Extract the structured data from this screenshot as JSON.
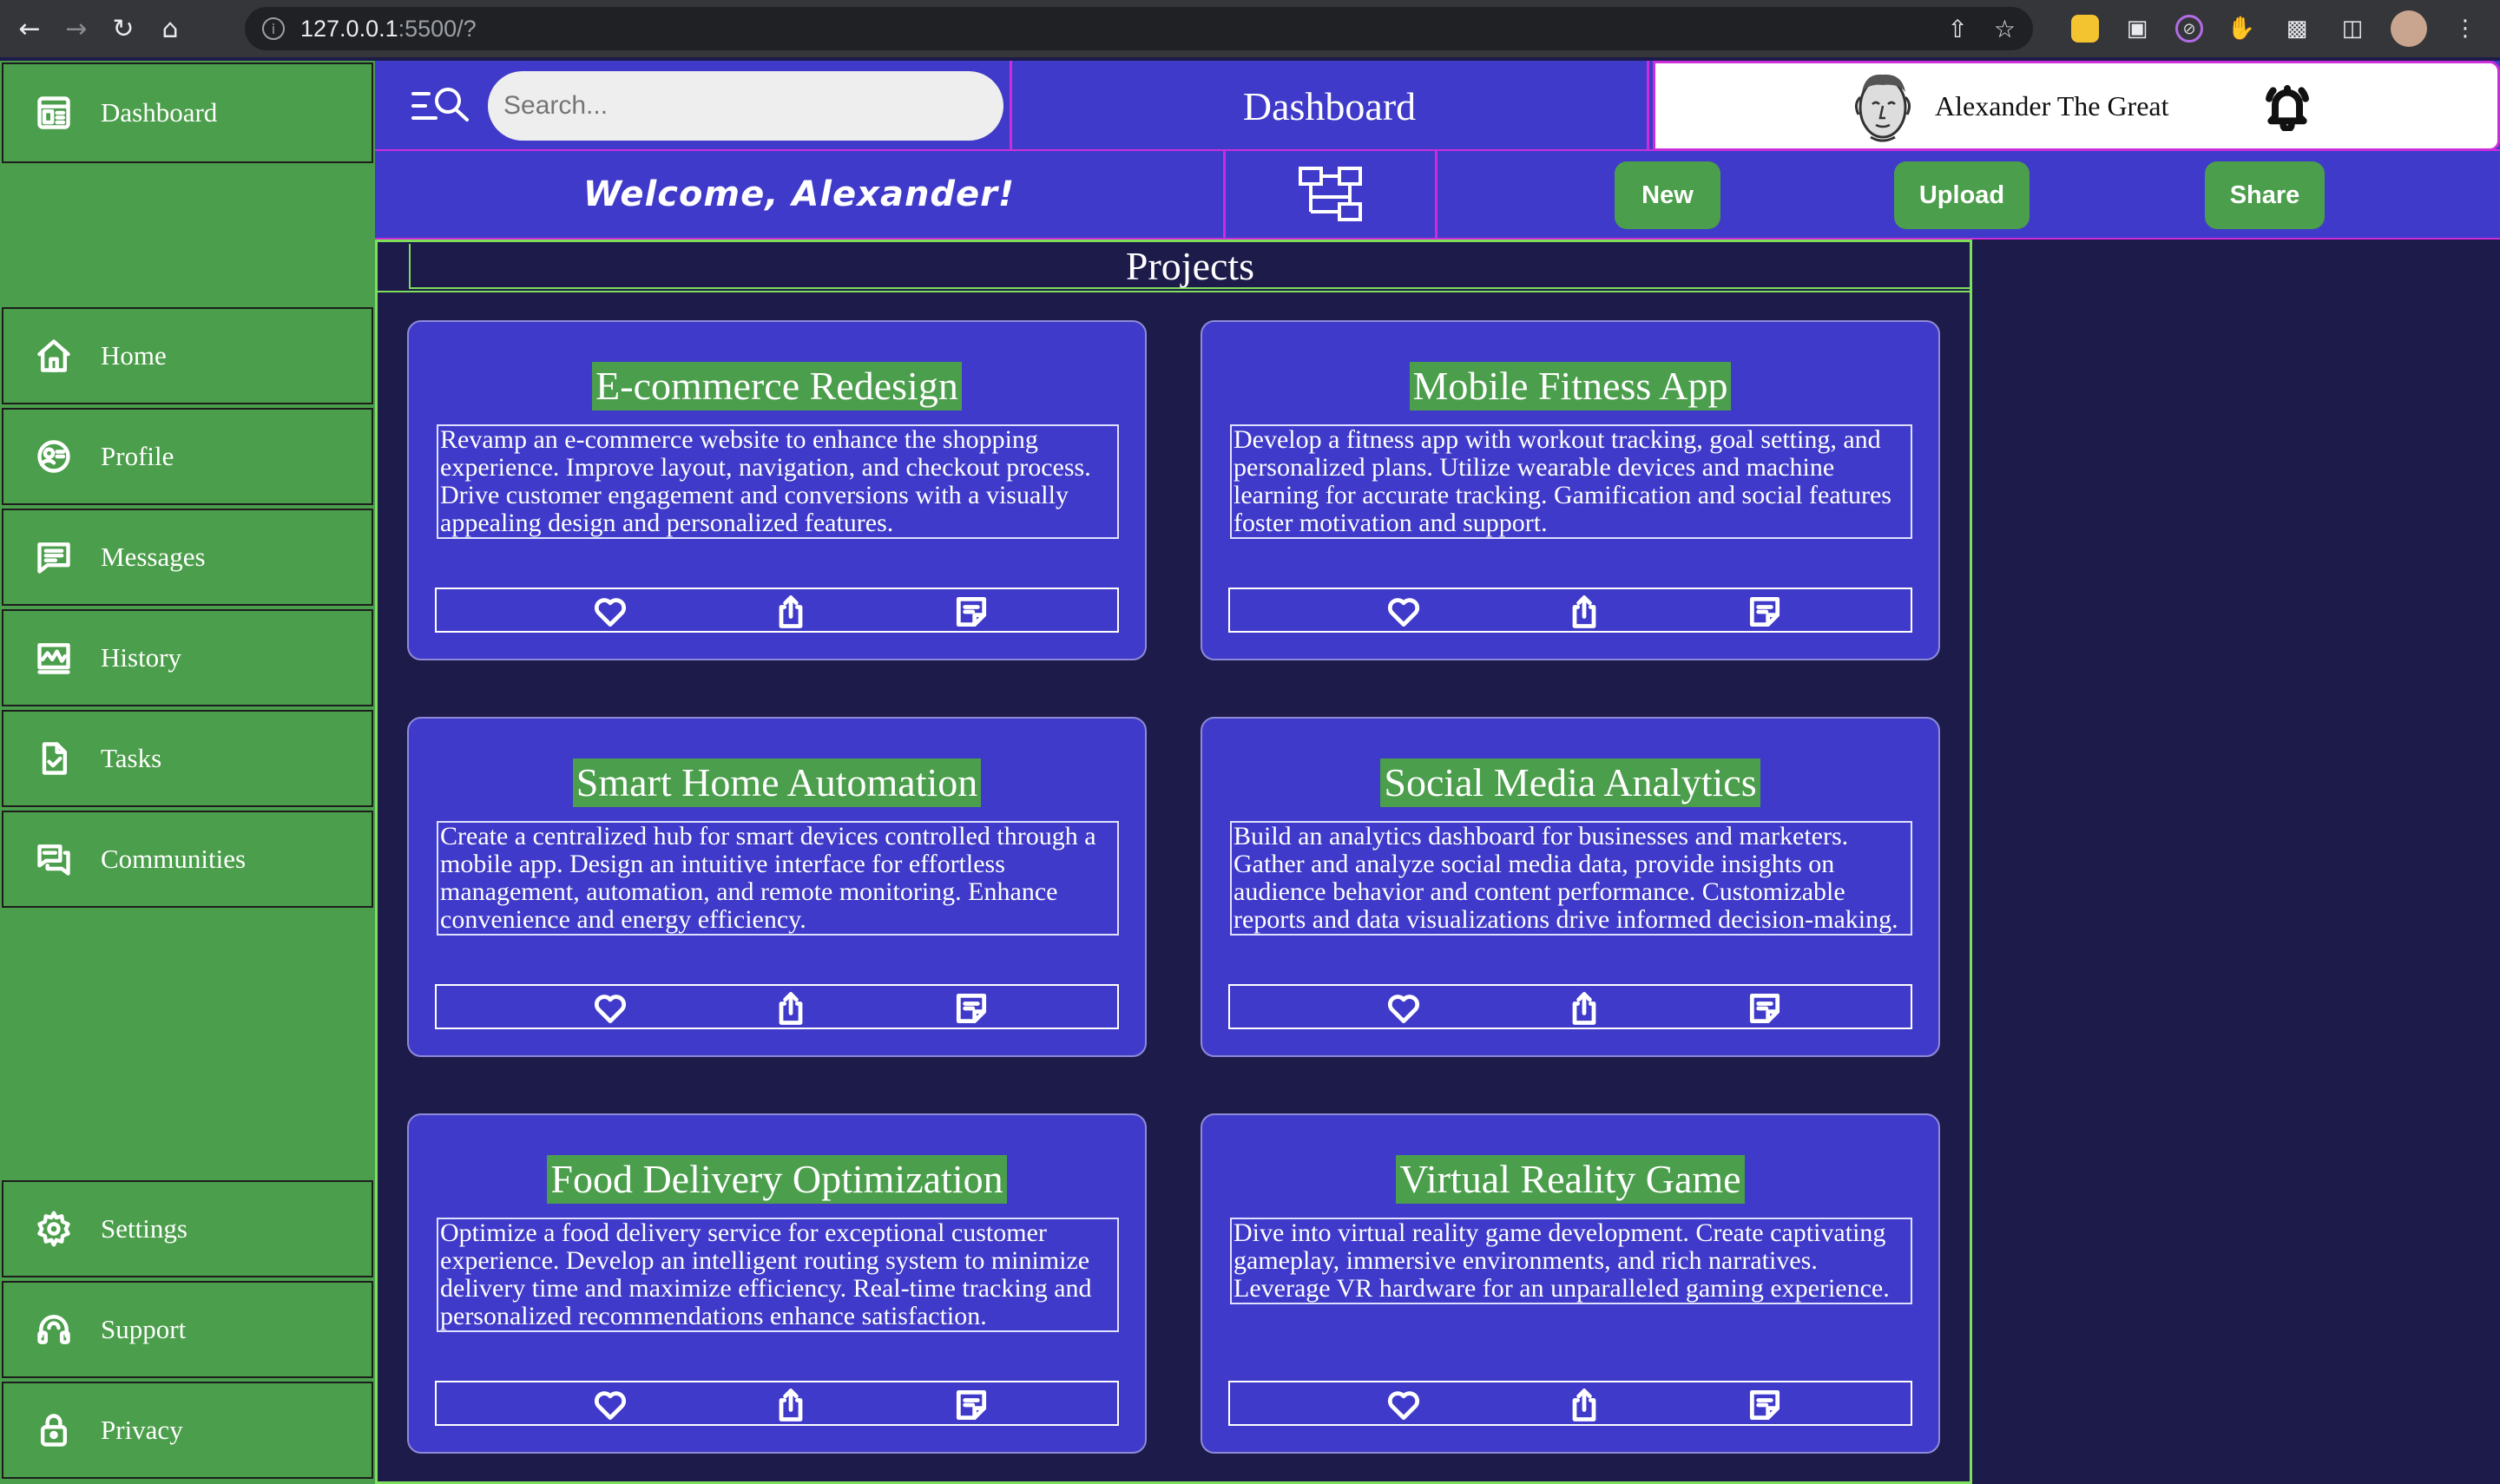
{
  "browser": {
    "url_host": "127.0.0.1",
    "url_rest": ":5500/?"
  },
  "sidebar": {
    "top": {
      "label": "Dashboard",
      "icon": "dashboard-icon"
    },
    "items": [
      {
        "label": "Home",
        "icon": "home-icon"
      },
      {
        "label": "Profile",
        "icon": "profile-icon"
      },
      {
        "label": "Messages",
        "icon": "messages-icon"
      },
      {
        "label": "History",
        "icon": "history-icon"
      },
      {
        "label": "Tasks",
        "icon": "tasks-icon"
      },
      {
        "label": "Communities",
        "icon": "communities-icon"
      }
    ],
    "bottom": [
      {
        "label": "Settings",
        "icon": "gear-icon"
      },
      {
        "label": "Support",
        "icon": "support-icon"
      },
      {
        "label": "Privacy",
        "icon": "lock-icon"
      }
    ]
  },
  "header": {
    "search_placeholder": "Search...",
    "title": "Dashboard",
    "user_name": "Alexander The Great"
  },
  "subheader": {
    "welcome": "Welcome, Alexander!",
    "new_label": "New",
    "upload_label": "Upload",
    "share_label": "Share"
  },
  "projects": {
    "heading": "Projects",
    "cards": [
      {
        "title": "E-commerce Redesign",
        "desc": "Revamp an e-commerce website to enhance the shopping experience. Improve layout, navigation, and checkout process. Drive customer engagement and conversions with a visually appealing design and personalized features."
      },
      {
        "title": "Mobile Fitness App",
        "desc": "Develop a fitness app with workout tracking, goal setting, and personalized plans. Utilize wearable devices and machine learning for accurate tracking. Gamification and social features foster motivation and support."
      },
      {
        "title": "Smart Home Automation",
        "desc": "Create a centralized hub for smart devices controlled through a mobile app. Design an intuitive interface for effortless management, automation, and remote monitoring. Enhance convenience and energy efficiency."
      },
      {
        "title": "Social Media Analytics",
        "desc": "Build an analytics dashboard for businesses and marketers. Gather and analyze social media data, provide insights on audience behavior and content performance. Customizable reports and data visualizations drive informed decision-making."
      },
      {
        "title": "Food Delivery Optimization",
        "desc": "Optimize a food delivery service for exceptional customer experience. Develop an intelligent routing system to minimize delivery time and maximize efficiency. Real-time tracking and personalized recommendations enhance satisfaction."
      },
      {
        "title": "Virtual Reality Game",
        "desc": "Dive into virtual reality game development. Create captivating gameplay, immersive environments, and rich narratives. Leverage VR hardware for an unparalleled gaming experience."
      }
    ]
  },
  "colors": {
    "sidebar": "#4b9e4b",
    "header": "#3f3ac9",
    "background": "#1c1b4a",
    "accent_border": "#cc2ddb",
    "main_border": "#7ee05a"
  }
}
